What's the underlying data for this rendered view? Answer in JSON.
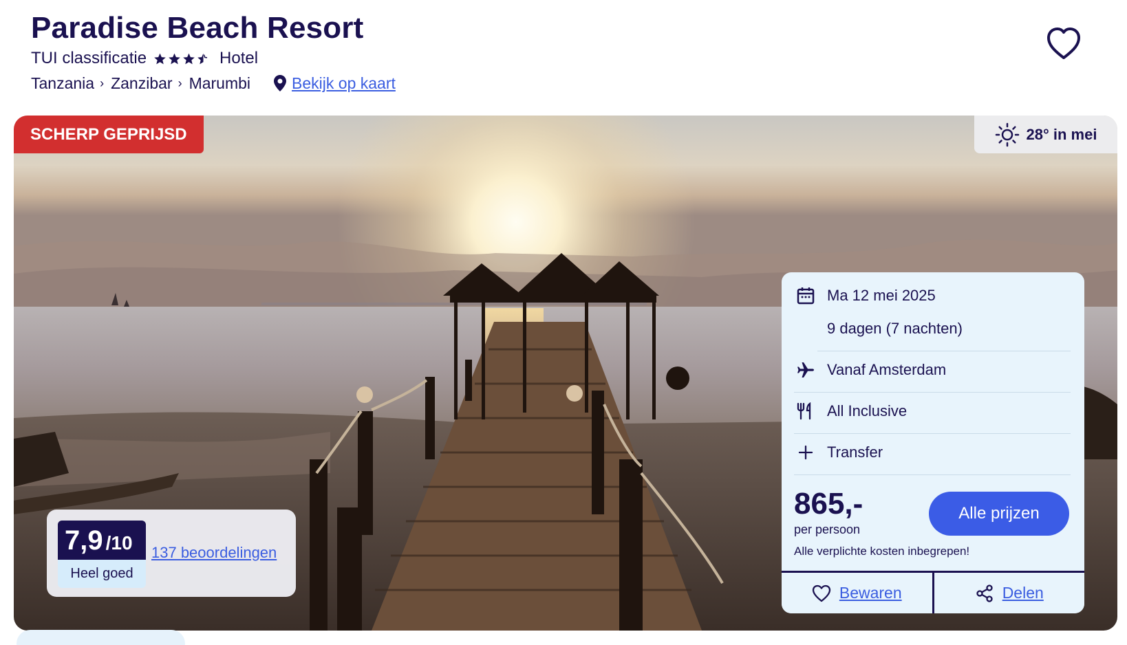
{
  "header": {
    "title": "Paradise Beach Resort",
    "classification_label": "TUI classificatie",
    "stars": 3.5,
    "type": "Hotel",
    "breadcrumb": [
      "Tanzania",
      "Zanzibar",
      "Marumbi"
    ],
    "map_link": "Bekijk op kaart"
  },
  "hero": {
    "badge": "SCHERP GEPRIJSD",
    "weather": "28° in mei",
    "weather_icon": "sun-icon"
  },
  "rating": {
    "score": "7,9",
    "scale": "/10",
    "label": "Heel goed",
    "reviews_link": "137 beoordelingen"
  },
  "booking": {
    "date": "Ma 12 mei 2025",
    "duration": "9 dagen (7 nachten)",
    "departure": "Vanaf Amsterdam",
    "board": "All Inclusive",
    "extra": "Transfer",
    "price": "865,-",
    "price_sub": "per persoon",
    "price_note": "Alle verplichte kosten inbegrepen!",
    "cta": "Alle prijzen",
    "save": "Bewaren",
    "share": "Delen"
  },
  "colors": {
    "navy": "#1a1150",
    "link": "#3a5de0",
    "badge_red": "#d22f2f",
    "card_bg": "#e8f4fc",
    "cta_blue": "#3b5ce6"
  }
}
